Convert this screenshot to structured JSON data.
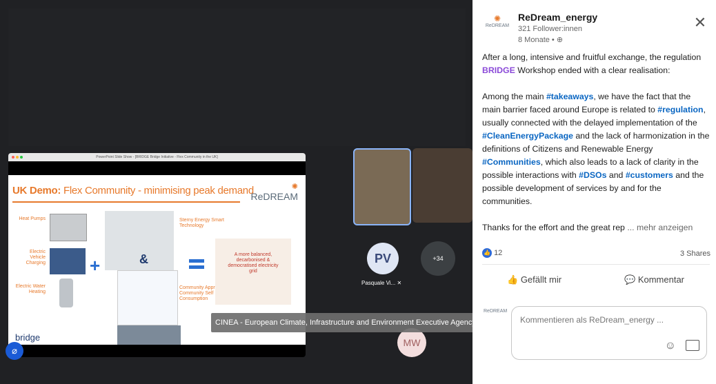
{
  "slide": {
    "window_title": "PowerPoint Slide Show - [BRIDGE Bridge Initiative - Flex Community in the UK]",
    "title_accent": "UK Demo:",
    "title_main": " Flex Community - minimising peak demand",
    "logo": "ReDREAM",
    "labels": {
      "heat_pumps": "Heat Pumps",
      "ev_charging": "Electric Vehicle Charging",
      "water_heating": "Electric Water Heating",
      "sterny": "Sterny Energy Smart Technology",
      "community": "Community Approach & Community Self Consumption",
      "grid": "A more balanced, decarbonised & democratised electricity grid",
      "bridge": "bridge"
    }
  },
  "participants": {
    "pv_initials": "PV",
    "pv_name": "Pasquale Vi...",
    "more_count": "+34",
    "mw_initials": "MW"
  },
  "tooltip": "CINEA - European Climate, Infrastructure and Environment Executive Agency",
  "post": {
    "company": "ReDream_energy",
    "followers": "321 Follower:innen",
    "age": "8 Monate •",
    "p1_before": "After a long, intensive and fruitful exchange, the regulation ",
    "p1_tag": "BRIDGE",
    "p1_after": " Workshop ended with a clear realisation:",
    "p2": [
      "Among the main ",
      "#takeaways",
      ", we have the fact that the main barrier faced around Europe is related to ",
      "#regulation",
      ", usually connected with the delayed implementation of the ",
      "#CleanEnergyPackage",
      " and the lack of harmonization in the definitions of Citizens and Renewable Energy ",
      "#Communities",
      ", which also leads to a lack of clarity in the possible interactions with ",
      "#DSOs",
      " and ",
      "#customers",
      " and the possible development of services by and for the communities."
    ],
    "p3": "Thanks for the effort and the great rep",
    "more": " ... mehr anzeigen",
    "reactions": "12",
    "shares": "3 Shares",
    "like_label": "Gefällt mir",
    "comment_label": "Kommentar",
    "comment_placeholder": "Kommentieren als ReDream_energy ..."
  },
  "colors": {
    "linkedin_blue": "#0a66c2",
    "bridge_purple": "#8b4ad8",
    "accent_orange": "#e7792b"
  }
}
